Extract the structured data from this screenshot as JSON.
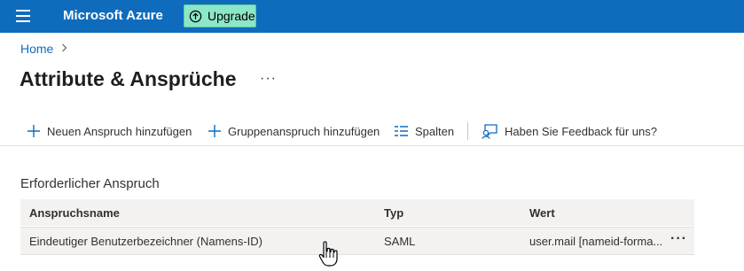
{
  "header": {
    "brand": "Microsoft Azure",
    "upgrade_label": "Upgrade",
    "menu_icon": "hamburger-icon",
    "upgrade_icon": "arrow-up-circle-icon"
  },
  "breadcrumb": {
    "home": "Home",
    "separator": ">"
  },
  "page": {
    "title": "Attribute & Ansprüche",
    "more": "···"
  },
  "toolbar": {
    "add_claim": "Neuen Anspruch hinzufügen",
    "add_group_claim": "Gruppenanspruch hinzufügen",
    "columns": "Spalten",
    "feedback": "Haben Sie Feedback für uns?"
  },
  "section": {
    "title": "Erforderlicher Anspruch"
  },
  "table": {
    "columns": [
      "Anspruchsname",
      "Typ",
      "Wert"
    ],
    "rows": [
      {
        "name": "Eindeutiger Benutzerbezeichner (Namens-ID)",
        "type": "SAML",
        "value": "user.mail [nameid-forma...",
        "more": "···"
      }
    ]
  },
  "colors": {
    "topbar": "#0f6cbd",
    "upgrade_bg": "#8ce6c8",
    "link": "#0f6cbd",
    "row_bg": "#f3f2f1"
  }
}
